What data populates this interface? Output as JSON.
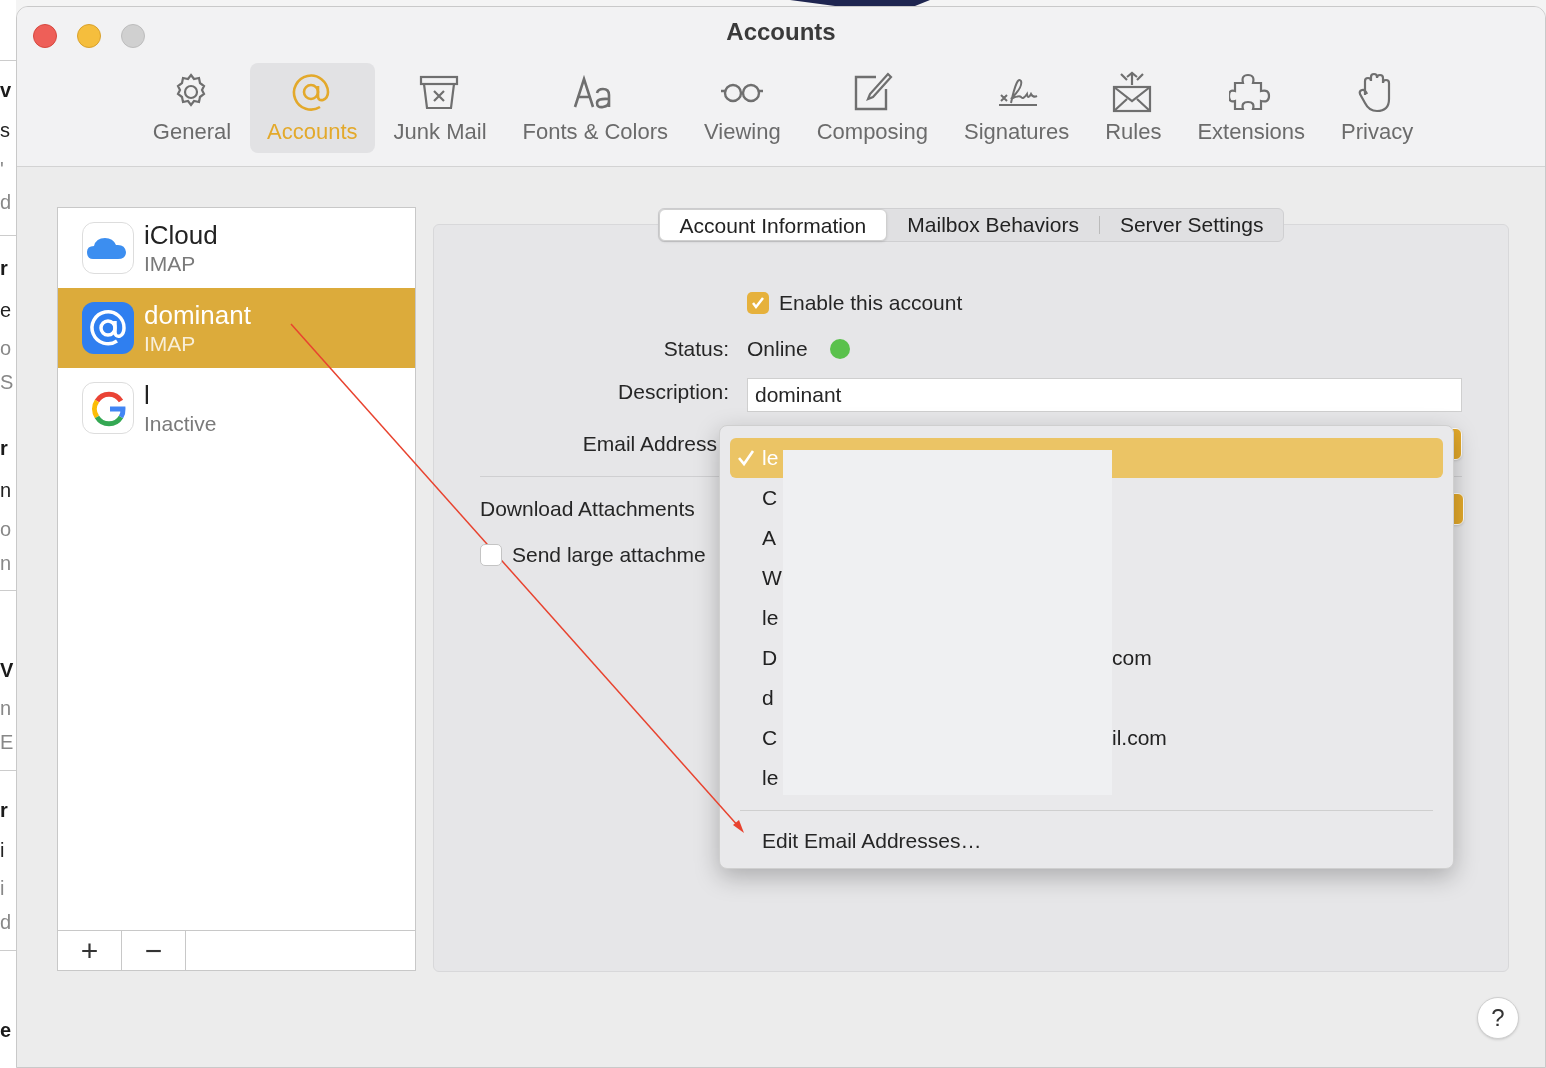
{
  "background": {
    "fragments": [
      {
        "text": "v",
        "kind": "heading"
      },
      {
        "text": "s",
        "kind": "body"
      },
      {
        "text": "'",
        "kind": "muted"
      },
      {
        "text": "d",
        "kind": "muted"
      },
      {
        "text": "r",
        "kind": "heading"
      },
      {
        "text": "e",
        "kind": "body"
      },
      {
        "text": "o",
        "kind": "muted"
      },
      {
        "text": "S",
        "kind": "muted"
      },
      {
        "text": "r",
        "kind": "heading"
      },
      {
        "text": "n",
        "kind": "body"
      },
      {
        "text": "o",
        "kind": "muted"
      },
      {
        "text": "n",
        "kind": "muted"
      },
      {
        "text": "V",
        "kind": "heading"
      },
      {
        "text": "n",
        "kind": "muted"
      },
      {
        "text": "E",
        "kind": "muted"
      },
      {
        "text": "r",
        "kind": "heading"
      },
      {
        "text": "i",
        "kind": "body"
      },
      {
        "text": "i",
        "kind": "muted"
      },
      {
        "text": "d",
        "kind": "muted"
      },
      {
        "text": "e",
        "kind": "heading"
      }
    ]
  },
  "window": {
    "title": "Accounts"
  },
  "toolbar": [
    {
      "label": "General",
      "selected": false
    },
    {
      "label": "Accounts",
      "selected": true
    },
    {
      "label": "Junk Mail",
      "selected": false
    },
    {
      "label": "Fonts & Colors",
      "selected": false
    },
    {
      "label": "Viewing",
      "selected": false
    },
    {
      "label": "Composing",
      "selected": false
    },
    {
      "label": "Signatures",
      "selected": false
    },
    {
      "label": "Rules",
      "selected": false
    },
    {
      "label": "Extensions",
      "selected": false
    },
    {
      "label": "Privacy",
      "selected": false
    }
  ],
  "accounts": [
    {
      "name": "iCloud",
      "type": "IMAP",
      "selected": false
    },
    {
      "name": "dominant",
      "type": "IMAP",
      "selected": true
    },
    {
      "name": "l",
      "type": "Inactive",
      "selected": false
    }
  ],
  "list_buttons": [
    "+",
    "−"
  ],
  "tabs": [
    {
      "label": "Account Information",
      "selected": true
    },
    {
      "label": "Mailbox Behaviors",
      "selected": false
    },
    {
      "label": "Server Settings",
      "selected": false
    }
  ],
  "form": {
    "enable": {
      "label": "Enable this account",
      "checked": true
    },
    "status": {
      "label": "Status:",
      "value": "Online",
      "online": true
    },
    "description": {
      "label": "Description:",
      "value": "dominant"
    },
    "email": {
      "label": "Email Address"
    },
    "download": {
      "label": "Download Attachments"
    },
    "send_large": {
      "label": "Send large attachme",
      "checked": false
    }
  },
  "menu": {
    "items": [
      {
        "prefix": "le",
        "selected": true
      },
      {
        "prefix": "C",
        "selected": false
      },
      {
        "prefix": "A",
        "selected": false
      },
      {
        "prefix": "W",
        "selected": false
      },
      {
        "prefix": "le",
        "selected": false
      },
      {
        "prefix": "D",
        "suffix": "com",
        "selected": false
      },
      {
        "prefix": "d",
        "selected": false
      },
      {
        "prefix": "C",
        "suffix": "il.com",
        "selected": false
      },
      {
        "prefix": "le",
        "selected": false
      }
    ],
    "footer": "Edit Email Addresses…"
  },
  "help": "?"
}
